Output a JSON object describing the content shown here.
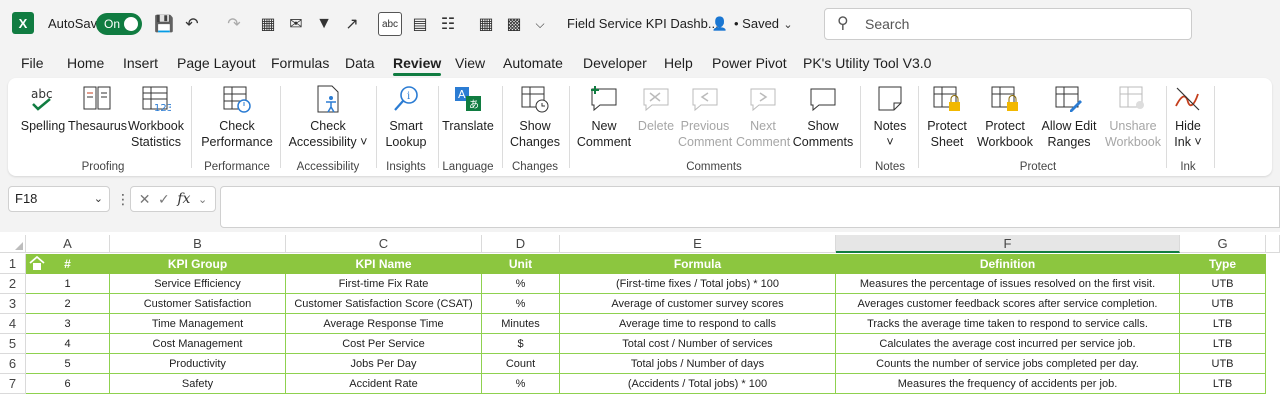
{
  "app": {
    "autosave_label": "AutoSave",
    "autosave_state": "On",
    "doc_title": "Field Service KPI Dashb...",
    "saved_status": "• Saved",
    "search_placeholder": "Search",
    "accent_color": "#107c41"
  },
  "menu": {
    "tabs": [
      "File",
      "Home",
      "Insert",
      "Page Layout",
      "Formulas",
      "Data",
      "Review",
      "View",
      "Automate",
      "Developer",
      "Help",
      "Power Pivot",
      "PK's Utility Tool V3.0"
    ],
    "active": "Review"
  },
  "ribbon": {
    "spelling": "Spelling",
    "thesaurus": "Thesaurus",
    "workbook_stats_1": "Workbook",
    "workbook_stats_2": "Statistics",
    "proofing": "Proofing",
    "check_perf_1": "Check",
    "check_perf_2": "Performance",
    "performance": "Performance",
    "check_acc_1": "Check",
    "check_acc_2": "Accessibility ˅",
    "accessibility": "Accessibility",
    "smart_1": "Smart",
    "smart_2": "Lookup",
    "insights": "Insights",
    "translate": "Translate",
    "language": "Language",
    "show_changes_1": "Show",
    "show_changes_2": "Changes",
    "changes": "Changes",
    "new_comment_1": "New",
    "new_comment_2": "Comment",
    "delete": "Delete",
    "previous_1": "Previous",
    "previous_2": "Comment",
    "next_1": "Next",
    "next_2": "Comment",
    "show_comments_1": "Show",
    "show_comments_2": "Comments",
    "comments": "Comments",
    "notes_btn": "Notes",
    "notes_chev": "˅",
    "notes": "Notes",
    "protect_sheet_1": "Protect",
    "protect_sheet_2": "Sheet",
    "protect_wb_1": "Protect",
    "protect_wb_2": "Workbook",
    "allow_edit_1": "Allow Edit",
    "allow_edit_2": "Ranges",
    "unshare_1": "Unshare",
    "unshare_2": "Workbook",
    "protect": "Protect",
    "hide_ink_1": "Hide",
    "hide_ink_2": "Ink ˅",
    "ink": "Ink"
  },
  "formula_bar": {
    "cell_ref": "F18",
    "fx": "fx",
    "formula_value": ""
  },
  "sheet": {
    "column_letters": [
      "A",
      "B",
      "C",
      "D",
      "E",
      "F",
      "G"
    ],
    "row_numbers": [
      "1",
      "2",
      "3",
      "4",
      "5",
      "6",
      "7"
    ],
    "header_color": "#8cc63f",
    "headers": [
      "#",
      "KPI Group",
      "KPI Name",
      "Unit",
      "Formula",
      "Definition",
      "Type"
    ],
    "rows": [
      [
        "1",
        "Service Efficiency",
        "First-time Fix Rate",
        "%",
        "(First-time fixes / Total jobs) * 100",
        "Measures the percentage of issues resolved on the first visit.",
        "UTB"
      ],
      [
        "2",
        "Customer Satisfaction",
        "Customer Satisfaction Score (CSAT)",
        "%",
        "Average of customer survey scores",
        "Averages customer feedback scores after service completion.",
        "UTB"
      ],
      [
        "3",
        "Time Management",
        "Average Response Time",
        "Minutes",
        "Average time to respond to calls",
        "Tracks the average time taken to respond to service calls.",
        "LTB"
      ],
      [
        "4",
        "Cost Management",
        "Cost Per Service",
        "$",
        "Total cost / Number of services",
        "Calculates the average cost incurred per service job.",
        "LTB"
      ],
      [
        "5",
        "Productivity",
        "Jobs Per Day",
        "Count",
        "Total jobs / Number of days",
        "Counts the number of service jobs completed per day.",
        "UTB"
      ],
      [
        "6",
        "Safety",
        "Accident Rate",
        "%",
        "(Accidents / Total jobs) * 100",
        "Measures the frequency of accidents per job.",
        "LTB"
      ]
    ]
  }
}
